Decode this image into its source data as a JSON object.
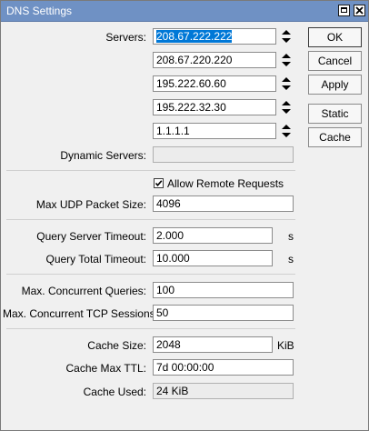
{
  "window": {
    "title": "DNS Settings"
  },
  "servers": {
    "label": "Servers:",
    "values": [
      "208.67.222.222",
      "208.67.220.220",
      "195.222.60.60",
      "195.222.32.30",
      "1.1.1.1"
    ]
  },
  "dynamic_servers": {
    "label": "Dynamic Servers:",
    "value": ""
  },
  "allow_remote_requests": {
    "label": "Allow Remote Requests",
    "checked": true
  },
  "max_udp_packet_size": {
    "label": "Max UDP Packet Size:",
    "value": "4096"
  },
  "query_server_timeout": {
    "label": "Query Server Timeout:",
    "value": "2.000",
    "unit": "s"
  },
  "query_total_timeout": {
    "label": "Query Total Timeout:",
    "value": "10.000",
    "unit": "s"
  },
  "max_concurrent_queries": {
    "label": "Max. Concurrent Queries:",
    "value": "100"
  },
  "max_concurrent_tcp_sessions": {
    "label": "Max. Concurrent TCP Sessions:",
    "value": "50"
  },
  "cache_size": {
    "label": "Cache Size:",
    "value": "2048",
    "unit": "KiB"
  },
  "cache_max_ttl": {
    "label": "Cache Max TTL:",
    "value": "7d 00:00:00"
  },
  "cache_used": {
    "label": "Cache Used:",
    "value": "24 KiB"
  },
  "buttons": {
    "ok": "OK",
    "cancel": "Cancel",
    "apply": "Apply",
    "static": "Static",
    "cache": "Cache"
  },
  "colors": {
    "titlebar": "#6f91c4",
    "selection": "#0078d7",
    "window_bg": "#f0f0f0"
  }
}
